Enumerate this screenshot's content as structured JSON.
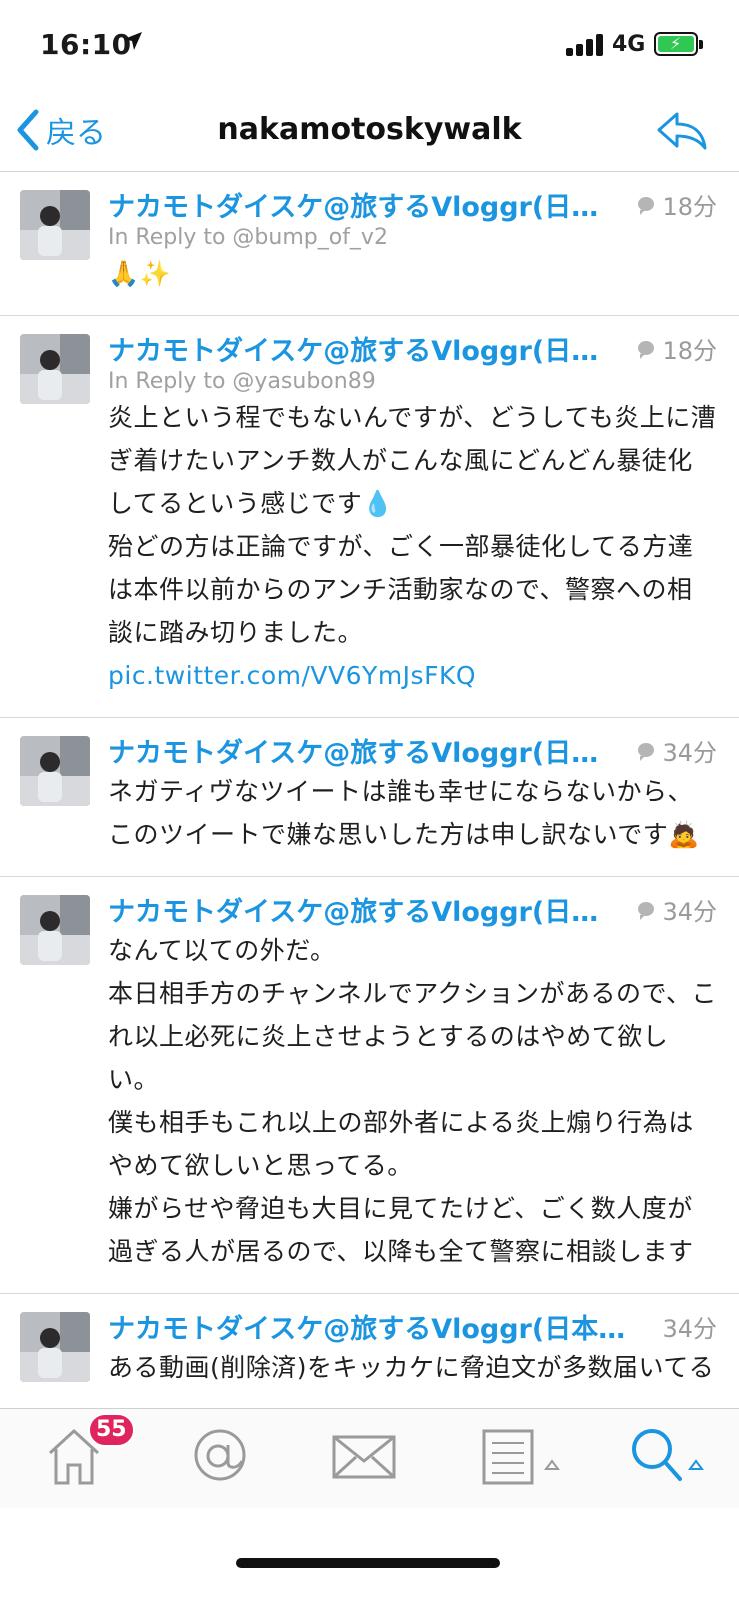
{
  "status": {
    "time": "16:10",
    "network": "4G"
  },
  "nav": {
    "back_label": "戻る",
    "title": "nakamotoskywalk"
  },
  "tweets": [
    {
      "name": "ナカモトダイスケ@旅するVloggr(日…",
      "time": "18分",
      "reply_to": "In Reply to @bump_of_v2",
      "lines": [
        "🙏✨"
      ]
    },
    {
      "name": "ナカモトダイスケ@旅するVloggr(日…",
      "time": "18分",
      "reply_to": "In Reply to @yasubon89",
      "lines": [
        "炎上という程でもないんですが、どうしても炎上に漕ぎ着けたいアンチ数人がこんな風にどんどん暴徒化してるという感じです💧",
        "殆どの方は正論ですが、ごく一部暴徒化してる方達は本件以前からのアンチ活動家なので、警察への相談に踏み切りました。"
      ],
      "link": "pic.twitter.com/VV6YmJsFKQ"
    },
    {
      "name": "ナカモトダイスケ@旅するVloggr(日…",
      "time": "34分",
      "lines": [
        "ネガティヴなツイートは誰も幸せにならないから、このツイートで嫌な思いした方は申し訳ないです🙇"
      ]
    },
    {
      "name": "ナカモトダイスケ@旅するVloggr(日…",
      "time": "34分",
      "lines": [
        "なんて以ての外だ。",
        "本日相手方のチャンネルでアクションがあるので、これ以上必死に炎上させようとするのはやめて欲しい。",
        "僕も相手もこれ以上の部外者による炎上煽り行為はやめて欲しいと思ってる。",
        "嫌がらせや脅迫も大目に見てたけど、ごく数人度が過ぎる人が居るので、以降も全て警察に相談します"
      ]
    },
    {
      "name": "ナカモトダイスケ@旅するVloggr(日本…",
      "time": "34分",
      "lines": [
        "ある動画(削除済)をキッカケに脅迫文が多数届いてる"
      ]
    }
  ],
  "tabbar": {
    "home_badge": "55"
  },
  "colors": {
    "accent": "#1b95e0",
    "badge": "#e0245e",
    "battery": "#31c753"
  },
  "icons": [
    "location-arrow-icon",
    "signal-icon",
    "battery-icon",
    "back-chevron-icon",
    "reply-all-icon",
    "comment-bubble-icon",
    "home-icon",
    "mention-icon",
    "mail-icon",
    "lists-icon",
    "search-icon"
  ]
}
